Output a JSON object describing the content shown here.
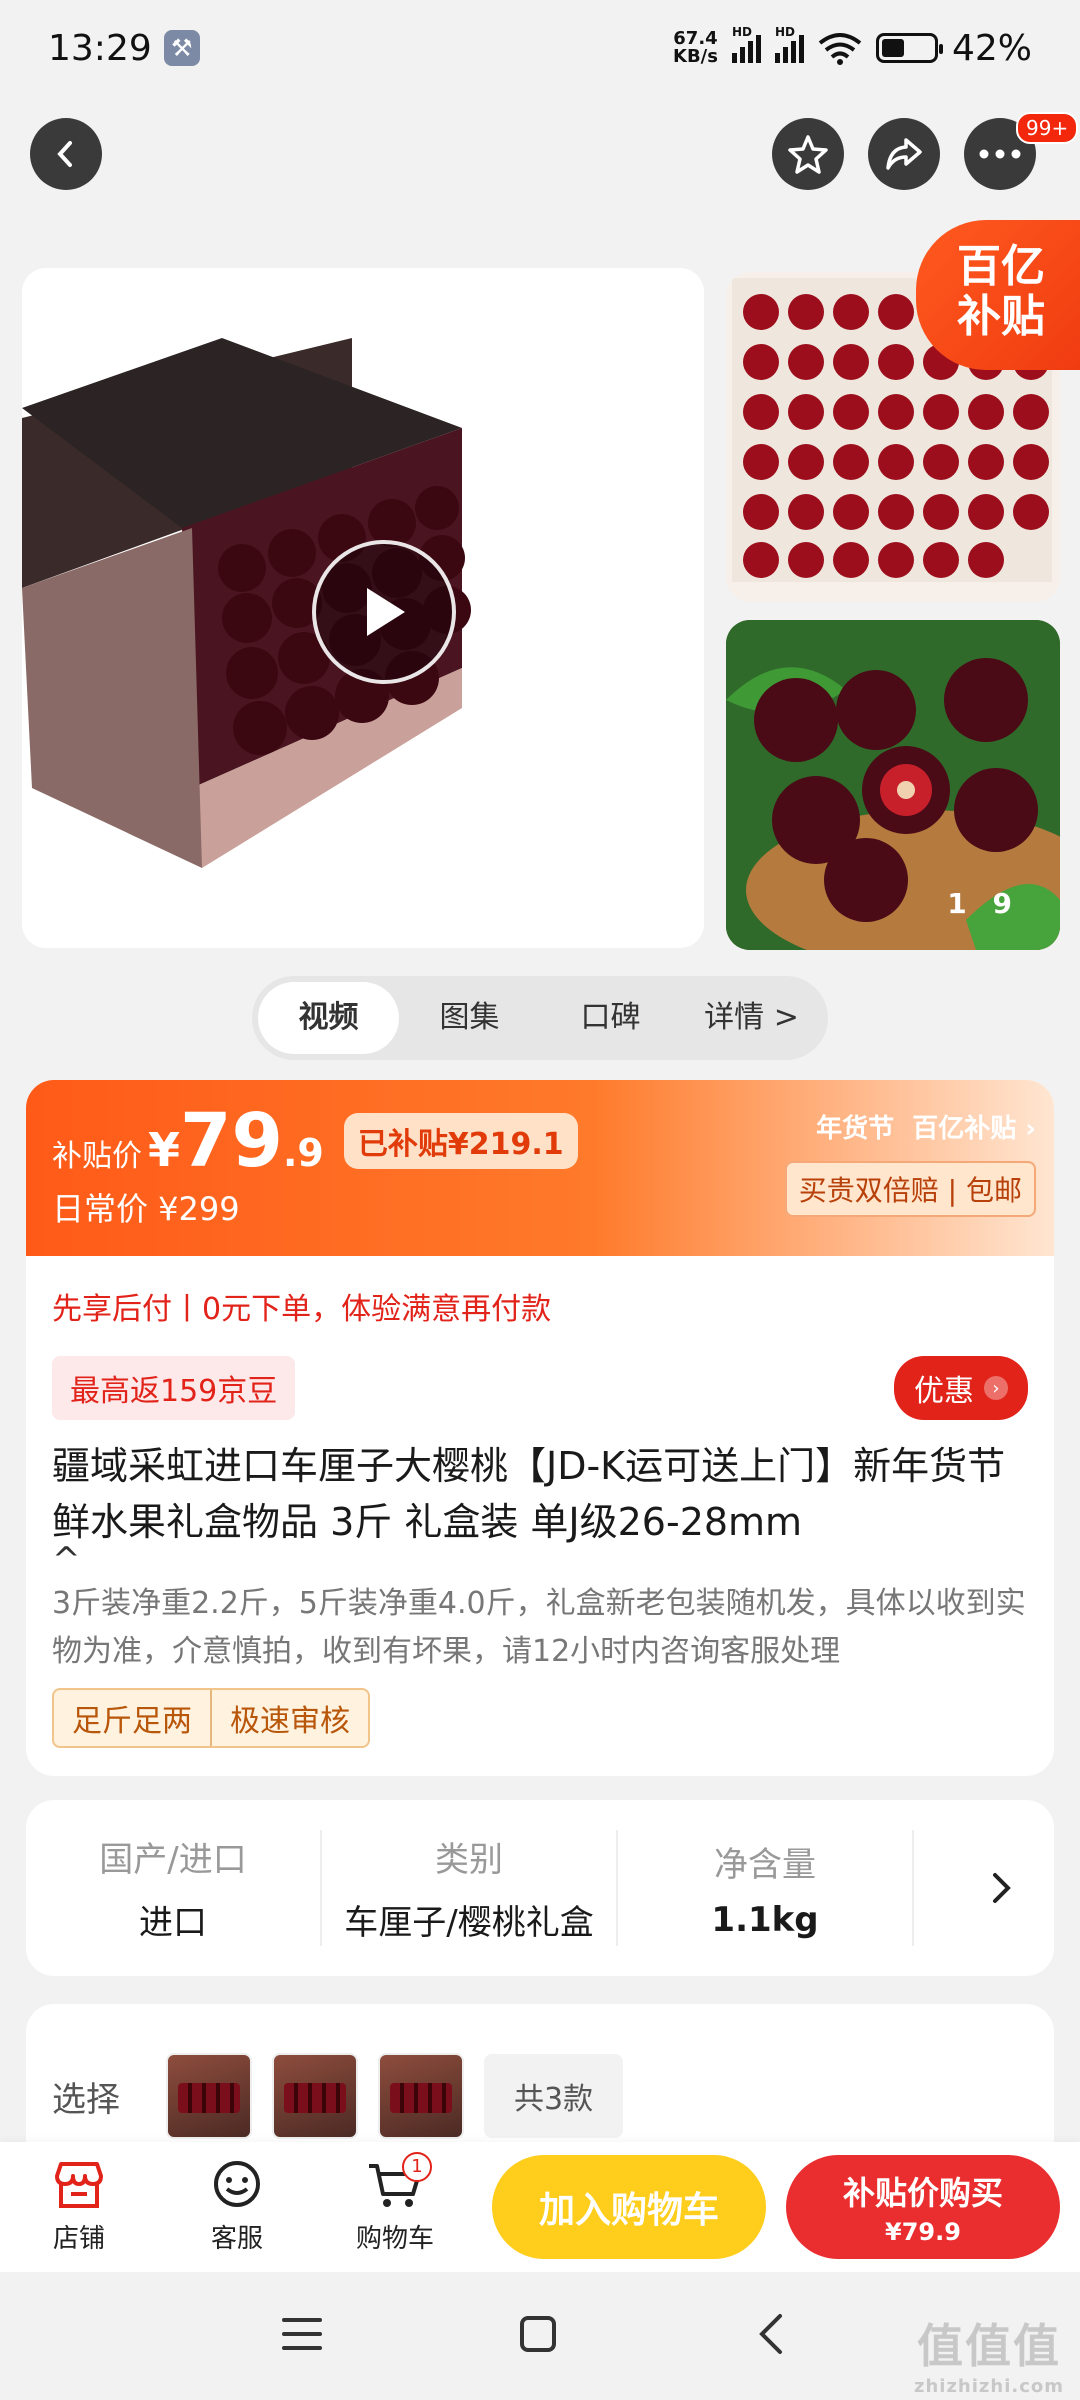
{
  "status": {
    "time": "13:29",
    "net_speed_value": "67.4",
    "net_speed_unit": "KB/s",
    "hd": "HD",
    "battery": "42%"
  },
  "topbar": {
    "more_badge": "99+"
  },
  "gallery": {
    "subsidy_tag_line1": "百亿",
    "subsidy_tag_line2": "补贴",
    "page_current": "1",
    "page_total": "9"
  },
  "media_tabs": [
    "视频",
    "图集",
    "口碑",
    "详情 >"
  ],
  "price": {
    "label": "补贴价",
    "currency": "¥",
    "integer": "79",
    "decimal": ".9",
    "subsidized": "已补贴¥219.1",
    "regular": "日常价 ¥299",
    "festival": "年货节",
    "campaign": "百亿补贴",
    "guarantee": "买贵双倍赔 | 包邮"
  },
  "product": {
    "pay_later": "先享后付丨0元下单，体验满意再付款",
    "jd_beans": "最高返159京豆",
    "discount_button": "优惠",
    "title": "疆域采虹进口车厘子大樱桃【JD-K运可送上门】新年货节鲜水果礼盒物品 3斤 礼盒装 单J级26-28mm",
    "description": "3斤装净重2.2斤，5斤装净重4.0斤，礼盒新老包装随机发，具体以收到实物为准，介意慎拍，收到有坏果，请12小时内咨询客服处理",
    "tags": [
      "足斤足两",
      "极速审核"
    ]
  },
  "specs": [
    {
      "key": "国产/进口",
      "value": "进口"
    },
    {
      "key": "类别",
      "value": "车厘子/樱桃礼盒"
    },
    {
      "key": "净含量",
      "value": "1.1kg"
    }
  ],
  "select": {
    "label": "选择",
    "count": "共3款"
  },
  "bottom": {
    "shop": "店铺",
    "service": "客服",
    "cart": "购物车",
    "cart_count": "1",
    "add_to_cart": "加入购物车",
    "buy_label": "补贴价购买",
    "buy_price": "¥79.9"
  },
  "watermark": {
    "main": "值值值",
    "sub": "zhizhizhi.com"
  },
  "colors": {
    "jd_red": "#e2231a",
    "orange": "#ff5a18",
    "yellow": "#ffcd1c"
  }
}
